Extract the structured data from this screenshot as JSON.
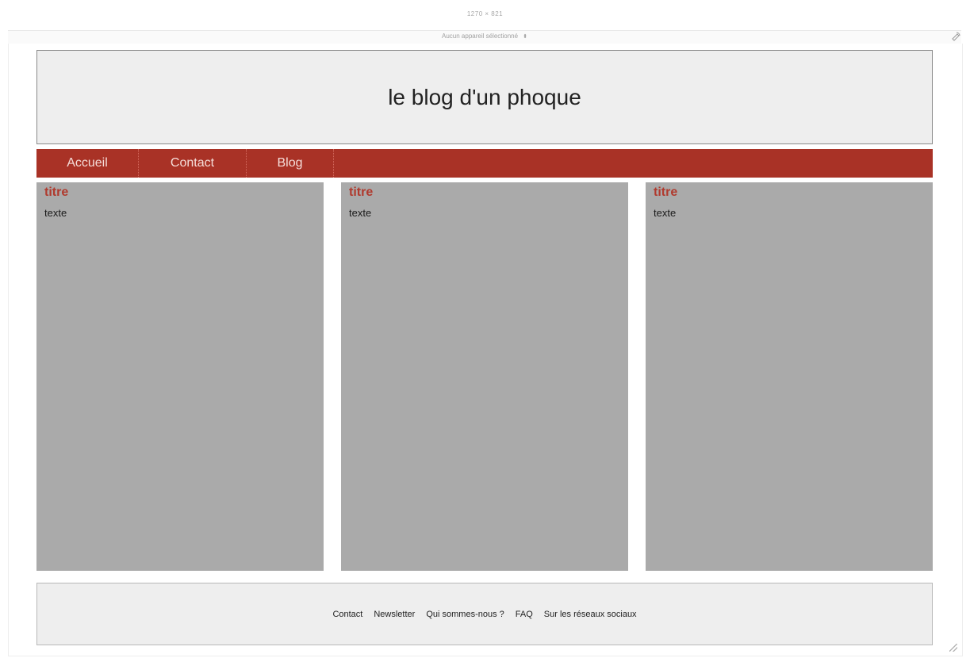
{
  "devtools": {
    "viewport_size": "1270  ×  821",
    "device_selector": "Aucun appareil sélectionné",
    "device_caret": "⬍",
    "rotate_icon": "rotate-device-icon"
  },
  "header": {
    "title": "le blog d'un phoque"
  },
  "nav": {
    "items": [
      {
        "label": "Accueil"
      },
      {
        "label": "Contact"
      },
      {
        "label": "Blog"
      }
    ]
  },
  "columns": [
    {
      "title": "titre",
      "text": "texte"
    },
    {
      "title": "titre",
      "text": "texte"
    },
    {
      "title": "titre",
      "text": "texte"
    }
  ],
  "footer": {
    "links": [
      {
        "label": "Contact"
      },
      {
        "label": "Newsletter"
      },
      {
        "label": "Qui sommes-nous ?"
      },
      {
        "label": "FAQ"
      },
      {
        "label": "Sur les réseaux sociaux"
      }
    ]
  },
  "colors": {
    "nav_bg": "#a93226",
    "title_accent": "#b03a2e",
    "column_bg": "#aaaaaa",
    "header_bg": "#eeeeee"
  }
}
